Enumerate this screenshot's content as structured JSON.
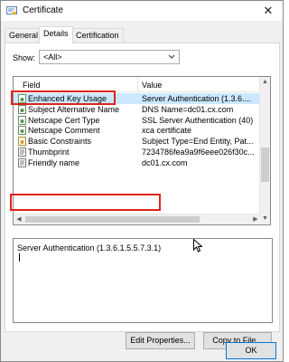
{
  "window": {
    "title": "Certificate",
    "close_glyph": "✕"
  },
  "tabs": [
    {
      "label": "General"
    },
    {
      "label": "Details"
    },
    {
      "label": "Certification Path"
    }
  ],
  "show": {
    "label": "Show:",
    "selected": "<All>"
  },
  "list": {
    "headers": {
      "field": "Field",
      "value": "Value"
    },
    "rows": [
      {
        "field": "Enhanced Key Usage",
        "value": "Server Authentication (1.3.6....",
        "icon": "certificate-extension-icon"
      },
      {
        "field": "Subject Alternative Name",
        "value": "DNS Name=dc01.cx.com",
        "icon": "certificate-extension-icon"
      },
      {
        "field": "Netscape Cert Type",
        "value": "SSL Server Authentication (40)",
        "icon": "certificate-extension-icon"
      },
      {
        "field": "Netscape Comment",
        "value": "xca certificate",
        "icon": "certificate-extension-icon"
      },
      {
        "field": "Basic Constraints",
        "value": "Subject Type=End Entity, Pat...",
        "icon": "critical-extension-icon"
      },
      {
        "field": "Thumbprint",
        "value": "7234786fea9a9f6eee026f30c...",
        "icon": "property-icon"
      },
      {
        "field": "Friendly name",
        "value": "dc01.cx.com",
        "icon": "property-icon"
      }
    ]
  },
  "detail": {
    "text": "Server Authentication (1.3.6.1.5.5.7.3.1)"
  },
  "buttons": {
    "edit_properties": "Edit Properties...",
    "copy_to_file": "Copy to File...",
    "ok": "OK"
  },
  "colors": {
    "highlight": "#e0231f",
    "selection": "#cce8ff",
    "ok_border": "#0078d7"
  }
}
